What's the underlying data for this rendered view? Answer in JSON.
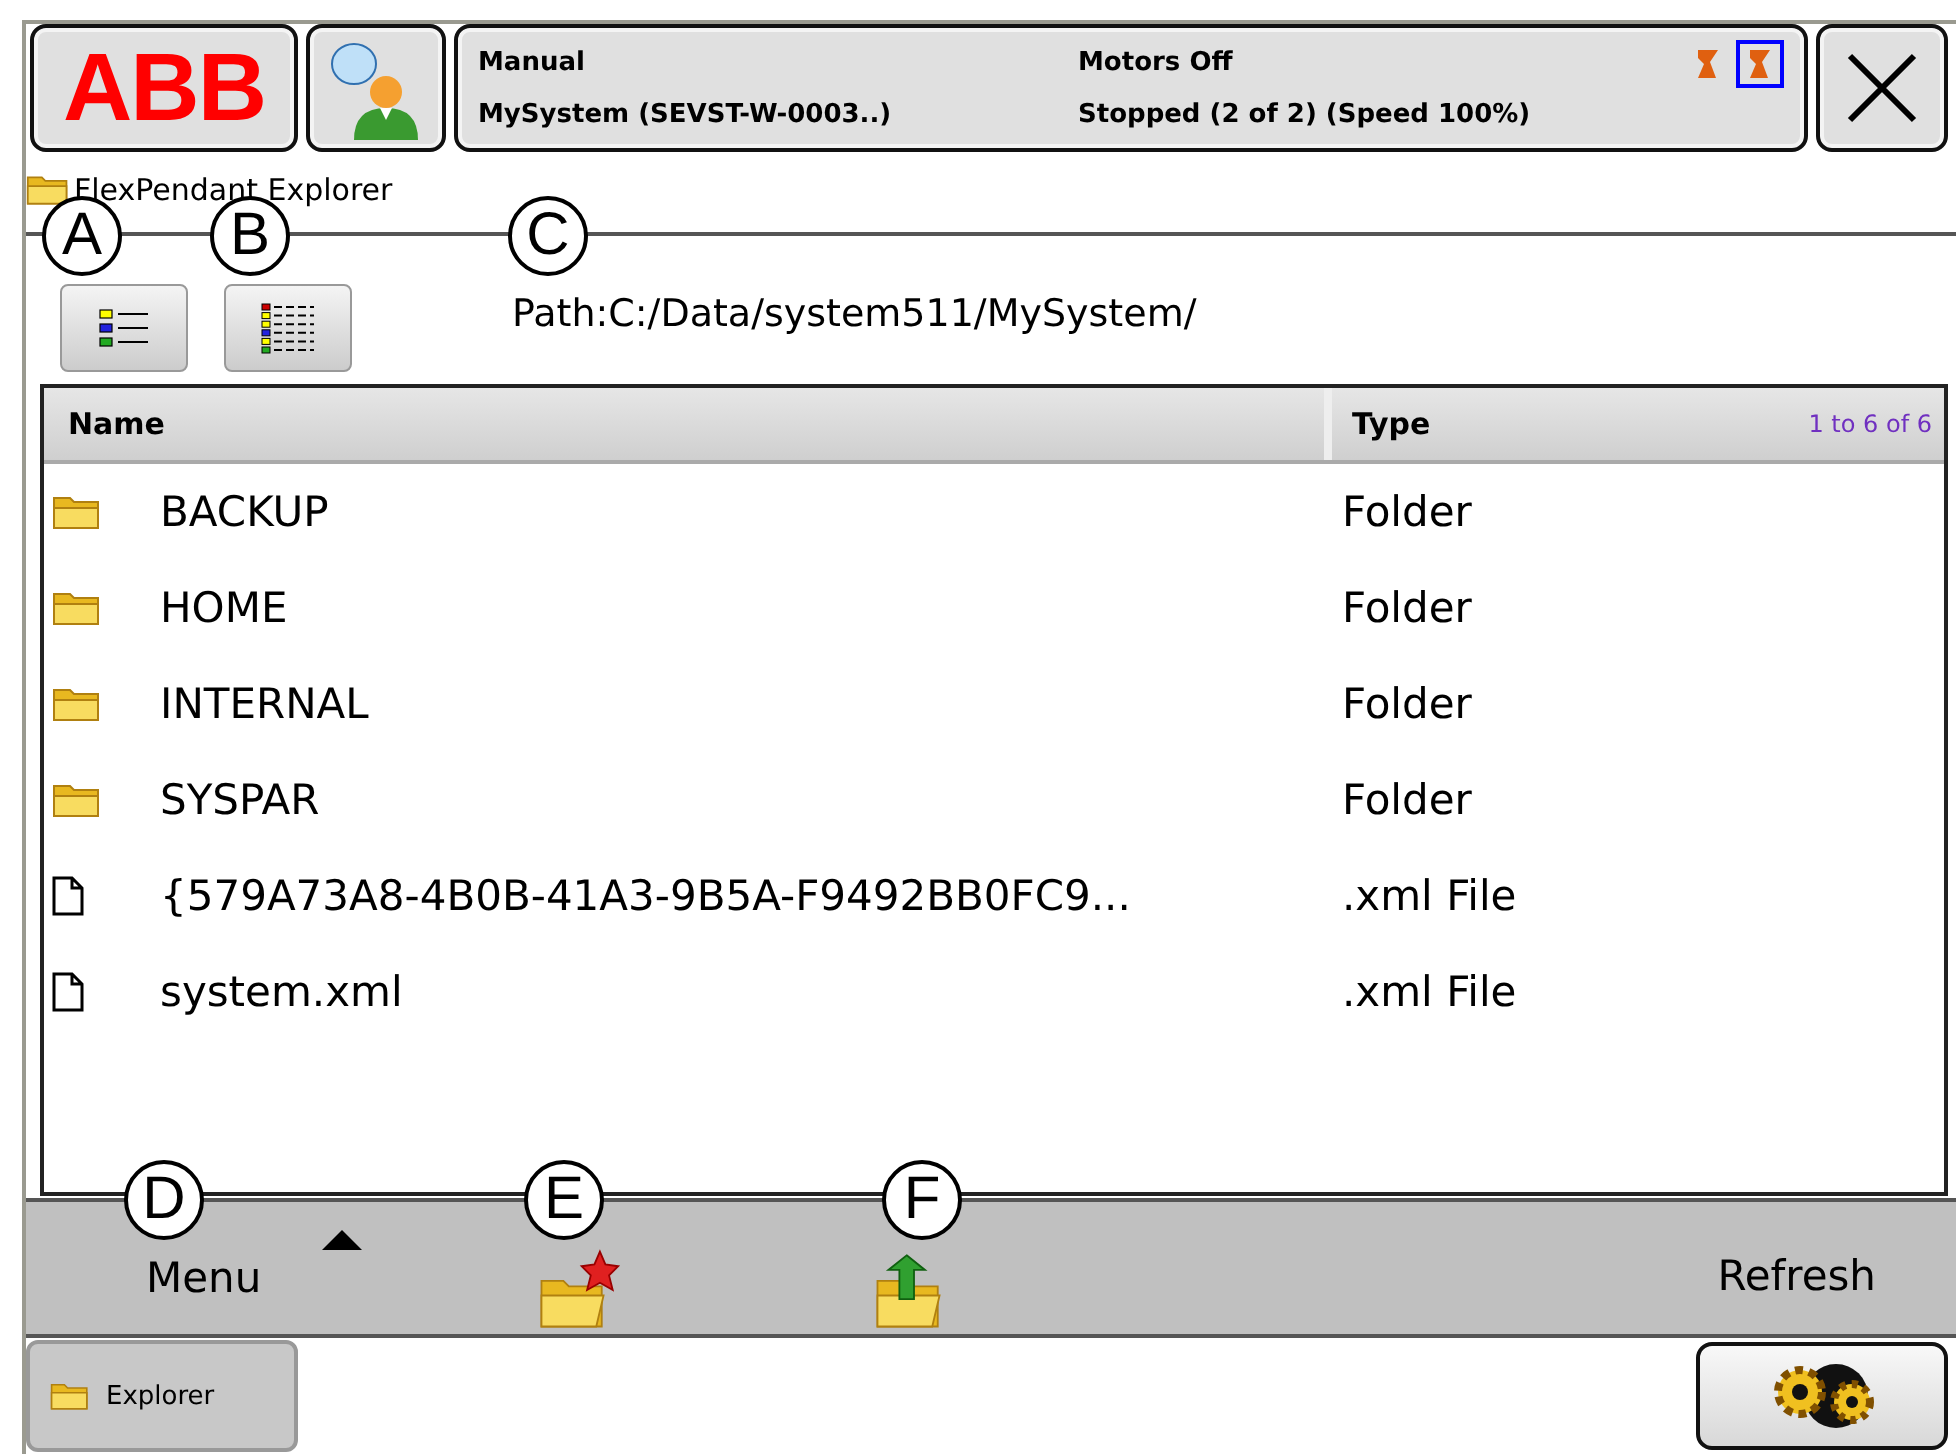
{
  "top_bar": {
    "logo": "ABB",
    "status": {
      "mode": "Manual",
      "system": "MySystem (SEVST-W-0003..)",
      "motors": "Motors Off",
      "state": "Stopped (2 of 2) (Speed 100%)"
    },
    "mech_units": [
      {
        "selected": false
      },
      {
        "selected": true
      }
    ]
  },
  "app_title": "FlexPendant Explorer",
  "path": "Path:C:/Data/system511/MySystem/",
  "table": {
    "columns": [
      "Name",
      "Type"
    ],
    "count": "1 to 6 of 6",
    "rows": [
      {
        "kind": "folder",
        "name": "BACKUP",
        "type": "Folder"
      },
      {
        "kind": "folder",
        "name": "HOME",
        "type": "Folder"
      },
      {
        "kind": "folder",
        "name": "INTERNAL",
        "type": "Folder"
      },
      {
        "kind": "folder",
        "name": "SYSPAR",
        "type": "Folder"
      },
      {
        "kind": "file",
        "name": "{579A73A8-4B0B-41A3-9B5A-F9492BB0FC9...",
        "type": ".xml File"
      },
      {
        "kind": "file",
        "name": "system.xml",
        "type": ".xml File"
      }
    ]
  },
  "command_bar": {
    "menu": "Menu",
    "refresh": "Refresh"
  },
  "taskbar": {
    "tasks": [
      {
        "label": "Explorer"
      }
    ]
  },
  "callouts": [
    "A",
    "B",
    "C",
    "D",
    "E",
    "F"
  ]
}
